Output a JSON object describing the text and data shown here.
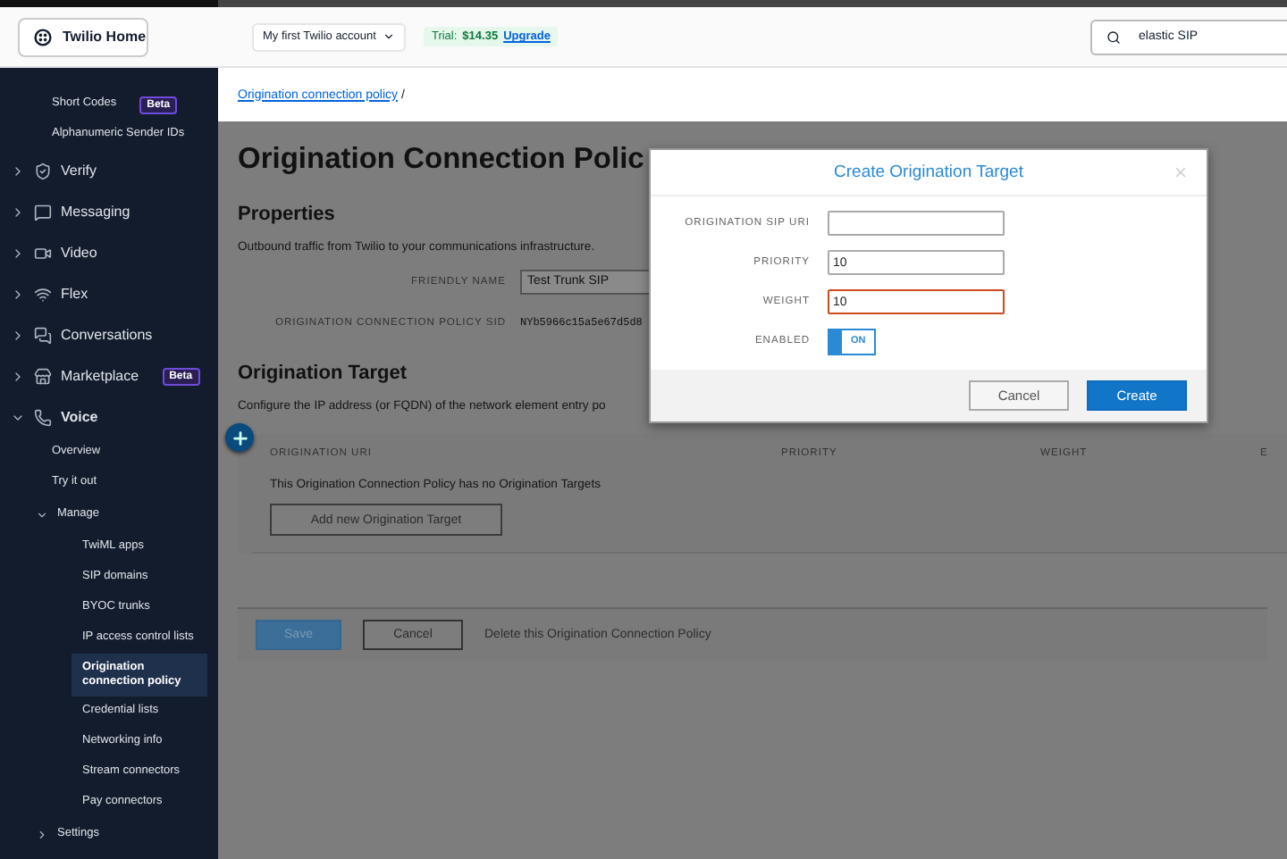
{
  "header": {
    "home": "Twilio Home",
    "account": "My first Twilio account",
    "trial_label": "Trial:",
    "trial_amount": "$14.35",
    "upgrade": "Upgrade",
    "search": {
      "value": "elastic SIP"
    }
  },
  "sidebar": {
    "items": [
      {
        "kind": "link",
        "label": "Short Codes",
        "badge": "Beta",
        "selected": false
      },
      {
        "kind": "link",
        "label": "Alphanumeric Sender IDs",
        "selected": false
      },
      {
        "kind": "section",
        "label": "Verify",
        "expanded": false
      },
      {
        "kind": "section",
        "label": "Messaging",
        "expanded": false
      },
      {
        "kind": "section",
        "label": "Video",
        "expanded": false
      },
      {
        "kind": "section",
        "label": "Flex",
        "expanded": false
      },
      {
        "kind": "section",
        "label": "Conversations",
        "expanded": false
      },
      {
        "kind": "section",
        "label": "Marketplace",
        "badge": "Beta",
        "expanded": false
      },
      {
        "kind": "section",
        "label": "Voice",
        "expanded": true,
        "children": [
          {
            "kind": "link",
            "label": "Overview",
            "selected": false
          },
          {
            "kind": "link",
            "label": "Try it out",
            "selected": false
          },
          {
            "kind": "group",
            "label": "Manage",
            "expanded": true,
            "children": [
              {
                "kind": "link",
                "label": "TwiML apps",
                "selected": false
              },
              {
                "kind": "link",
                "label": "SIP domains",
                "selected": false
              },
              {
                "kind": "link",
                "label": "BYOC trunks",
                "selected": false
              },
              {
                "kind": "link",
                "label": "IP access control lists",
                "selected": false
              },
              {
                "kind": "link",
                "label": "Origination connection policy",
                "selected": true
              },
              {
                "kind": "link",
                "label": "Credential lists",
                "selected": false
              },
              {
                "kind": "link",
                "label": "Networking info",
                "selected": false
              },
              {
                "kind": "link",
                "label": "Stream connectors",
                "selected": false
              },
              {
                "kind": "link",
                "label": "Pay connectors",
                "selected": false
              }
            ]
          },
          {
            "kind": "group",
            "label": "Settings",
            "expanded": false
          }
        ]
      }
    ]
  },
  "breadcrumb": {
    "link": "Origination connection policy",
    "separator": "/"
  },
  "page": {
    "title": "Origination Connection Polic",
    "properties_heading": "Properties",
    "properties_text": "Outbound traffic from Twilio to your communications infrastructure.",
    "fields": [
      {
        "label": "FRIENDLY NAME",
        "value": "Test Trunk SIP",
        "kind": "input"
      },
      {
        "label": "ORIGINATION CONNECTION POLICY SID",
        "value": "NYb5966c15a5e67d5d8",
        "kind": "text"
      }
    ],
    "target_heading": "Origination Target",
    "target_text": "Configure the IP address (or FQDN) of the network element entry po",
    "table": {
      "columns": [
        "ORIGINATION URI",
        "PRIORITY",
        "WEIGHT",
        "E"
      ],
      "empty": "This Origination Connection Policy has no Origination Targets",
      "add_button": "Add new Origination Target"
    },
    "footer": {
      "save": "Save",
      "cancel": "Cancel",
      "delete": "Delete this Origination Connection Policy"
    }
  },
  "modal": {
    "title": "Create Origination Target",
    "fields": [
      {
        "label": "ORIGINATION SIP URI",
        "kind": "input",
        "invalid": false
      },
      {
        "label": "PRIORITY",
        "kind": "input",
        "value": "10",
        "invalid": false
      },
      {
        "label": "WEIGHT",
        "kind": "input",
        "value": "10",
        "invalid": true
      },
      {
        "label": "ENABLED",
        "kind": "toggle",
        "on": true,
        "text": "ON"
      }
    ],
    "buttons": [
      {
        "label": "Cancel",
        "kind": "secondary"
      },
      {
        "label": "Create",
        "kind": "primary"
      }
    ]
  }
}
